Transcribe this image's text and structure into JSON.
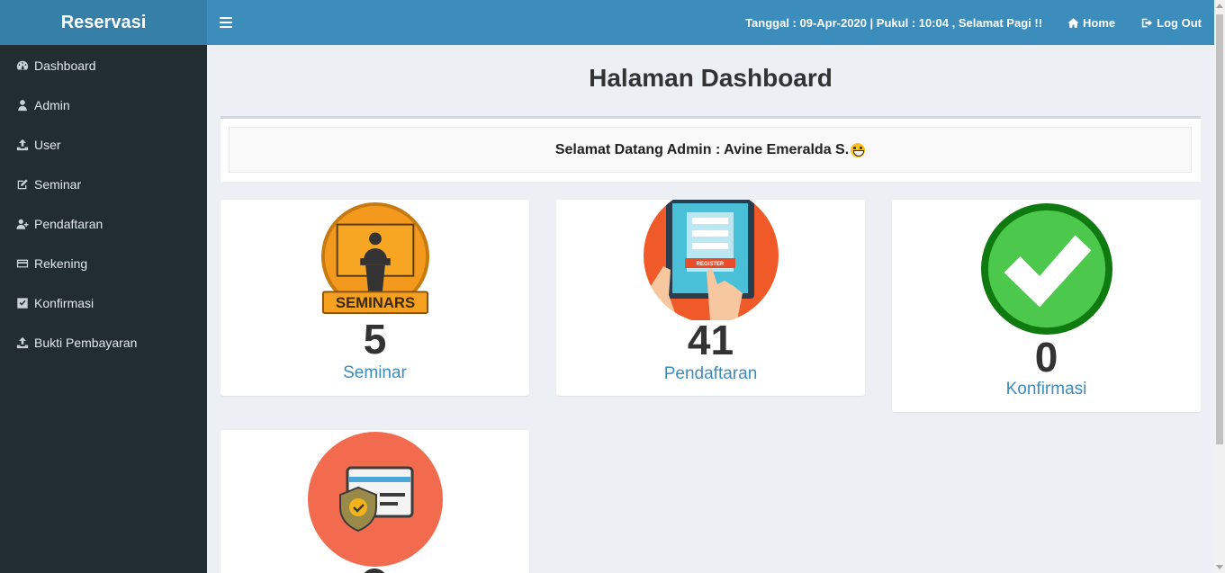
{
  "app": {
    "brand": "Reservasi"
  },
  "sidebar": {
    "items": [
      {
        "label": "Dashboard",
        "icon": "dashboard-icon"
      },
      {
        "label": "Admin",
        "icon": "user-icon"
      },
      {
        "label": "User",
        "icon": "upload-icon"
      },
      {
        "label": "Seminar",
        "icon": "edit-icon"
      },
      {
        "label": "Pendaftaran",
        "icon": "user-plus-icon"
      },
      {
        "label": "Rekening",
        "icon": "credit-card-icon"
      },
      {
        "label": "Konfirmasi",
        "icon": "check-square-icon"
      },
      {
        "label": "Bukti Pembayaran",
        "icon": "upload-icon"
      }
    ]
  },
  "header": {
    "tanggal_label": "Tanggal : ",
    "tanggal": "09-Apr-2020",
    "pukul_label": " | Pukul : ",
    "pukul": "10:04",
    "greeting": " , Selamat Pagi !!",
    "home": "Home",
    "logout": "Log Out"
  },
  "main": {
    "title": "Halaman Dashboard",
    "welcome": "Selamat Datang Admin : Avine Emeralda S.",
    "cards": [
      {
        "count": "5",
        "label": "Seminar",
        "icon": "seminars-icon",
        "badge": "SEMINARS"
      },
      {
        "count": "41",
        "label": "Pendaftaran",
        "icon": "register-icon",
        "badge": "REGISTER"
      },
      {
        "count": "0",
        "label": "Konfirmasi",
        "icon": "check-circle-icon"
      },
      {
        "count": "",
        "label": "",
        "icon": "payment-card-icon"
      }
    ]
  },
  "colors": {
    "navbar": "#3c8dbc",
    "brand_bg": "#367fa9",
    "sidebar": "#222d32",
    "content_bg": "#ecf0f5",
    "link": "#3c8dbc"
  }
}
